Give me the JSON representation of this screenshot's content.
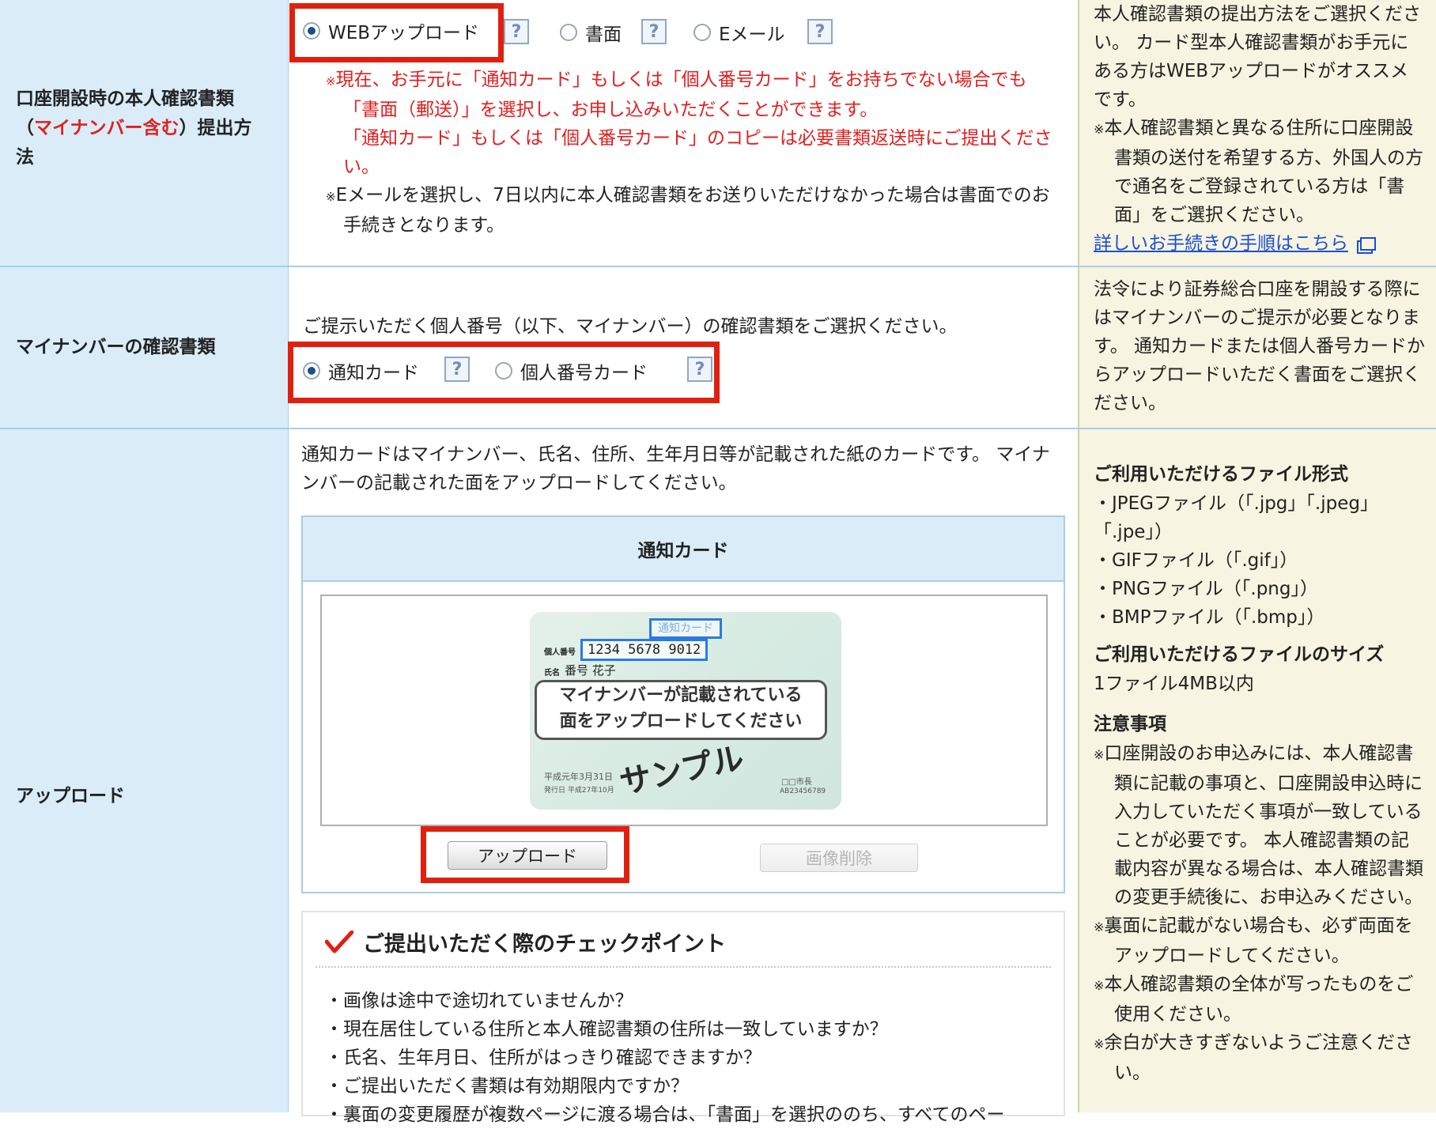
{
  "rows": {
    "submission": {
      "label_pre": "口座開設時の本人確認書類",
      "label_open": "（",
      "label_red": "マイナンバー含む",
      "label_post": "）提出方",
      "label_line3": "法",
      "options": [
        {
          "label": "WEBアップロード",
          "selected": true
        },
        {
          "label": "書面",
          "selected": false
        },
        {
          "label": "Eメール",
          "selected": false
        }
      ],
      "help_icon": "?",
      "notes": {
        "red_1": "現在、お手元に「通知カード」もしくは「個人番号カード」をお持ちでない場合でも「書面（郵送）」を選択し、お申し込みいただくことができます。",
        "red_2": "「通知カード」もしくは「個人番号カード」のコピーは必要書類返送時にご提出ください。",
        "black_1": "Eメールを選択し、7日以内に本人確認書類をお送りいただけなかった場合は書面でのお手続きとなります。"
      },
      "help": {
        "p1": "本人確認書類の提出方法をご選択ください。 カード型本人確認書類がお手元にある方はWEBアップロードがオススメです。",
        "p2": "本人確認書類と異なる住所に口座開設書類の送付を希望する方、外国人の方で通名をご登録されている方は「書面」をご選択ください。",
        "link": "詳しいお手続きの手順はこちら"
      }
    },
    "mynumber": {
      "label": "マイナンバーの確認書類",
      "prompt": "ご提示いただく個人番号（以下、マイナンバー）の確認書類をご選択ください。",
      "options": [
        {
          "label": "通知カード",
          "selected": true
        },
        {
          "label": "個人番号カード",
          "selected": false
        }
      ],
      "help": "法令により証券総合口座を開設する際にはマイナンバーのご提示が必要となります。 通知カードまたは個人番号カードからアップロードいただく書面をご選択ください。"
    },
    "upload": {
      "label": "アップロード",
      "intro": "通知カードはマイナンバー、氏名、住所、生年月日等が記載された紙のカードです。 マイナンバーの記載された面をアップロードしてください。",
      "panel_title": "通知カード",
      "card": {
        "tag": "通知カード",
        "number_label": "個人番号",
        "number": "1234 5678 9012",
        "name_label": "氏名",
        "name": "番号 花子",
        "bubble_line1": "マイナンバーが記載されている",
        "bubble_line2": "面をアップロードしてください",
        "sample": "サンプル",
        "date": "平成元年3月31日",
        "issue": "発行日 平成27年10月",
        "mayor": "□□市長",
        "serial": "AB23456789"
      },
      "upload_button": "アップロード",
      "delete_button": "画像削除",
      "check_title": "ご提出いただく際のチェックポイント",
      "checks": [
        "・画像は途中で途切れていませんか？",
        "・現在居住している住所と本人確認書類の住所は一致していますか？",
        "・氏名、生年月日、住所がはっきり確認できますか？",
        "・ご提出いただく書類は有効期限内ですか？",
        "・裏面の変更履歴が複数ページに渡る場合は、「書面」を選択ののち、すべてのペー"
      ],
      "help": {
        "formats_title": "ご利用いただけるファイル形式",
        "formats": [
          "・JPEGファイル（「.jpg」「.jpeg」「.jpe」）",
          "・GIFファイル（「.gif」）",
          "・PNGファイル（「.png」）",
          "・BMPファイル（「.bmp」）"
        ],
        "size_title": "ご利用いただけるファイルのサイズ",
        "size": "1ファイル4MB以内",
        "notes_title": "注意事項",
        "notes": [
          "口座開設のお申込みには、本人確認書類に記載の事項と、口座開設申込時に入力していただく事項が一致していることが必要です。 本人確認書類の記載内容が異なる場合は、本人確認書類の変更手続後に、お申込みください。",
          "裏面に記載がない場合も、必ず両面をアップロードしてください。",
          "本人確認書類の全体が写ったものをご使用ください。",
          "余白が大きすぎないようご注意ください。"
        ]
      }
    }
  },
  "note_mark": "※",
  "colors": {
    "label_bg": "#d9ecf8",
    "help_bg": "#f7f4e1",
    "highlight": "#e0200f",
    "red_text": "#e02020",
    "link": "#1a4fd1"
  }
}
